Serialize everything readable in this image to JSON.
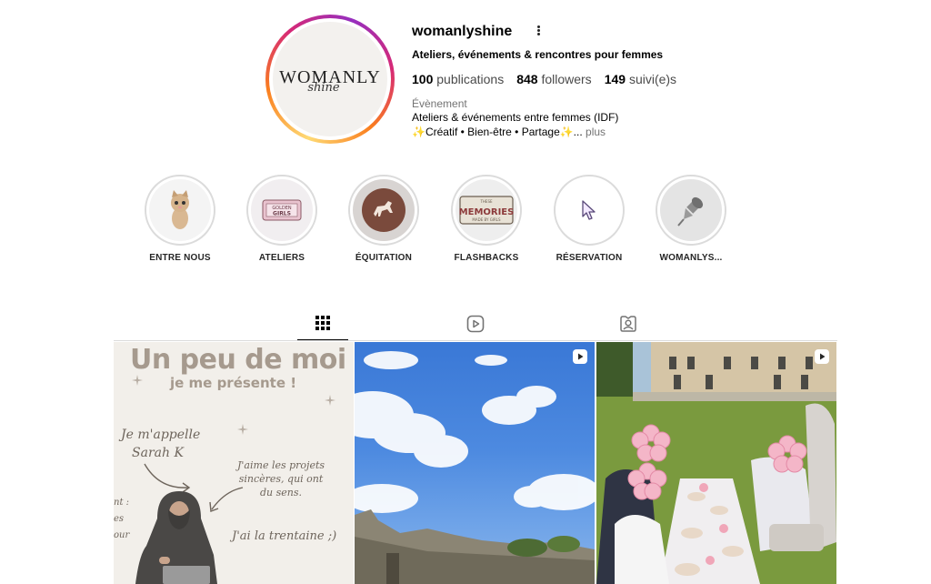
{
  "profile": {
    "username": "womanlyshine",
    "full_name": "Ateliers, événements & rencontres pour femmes",
    "avatar_logo_main": "WOMANLY",
    "avatar_logo_sub": "shine",
    "stats": {
      "posts_count": "100",
      "posts_label": "publications",
      "followers_count": "848",
      "followers_label": "followers",
      "following_count": "149",
      "following_label": "suivi(e)s"
    },
    "category": "Évènement",
    "bio_line1": "Ateliers & événements entre femmes (IDF)",
    "bio_line2": "✨Créatif • Bien-être • Partage✨...",
    "bio_more": "plus"
  },
  "highlights": [
    {
      "label": "ENTRE NOUS",
      "icon": "kitten-icon"
    },
    {
      "label": "ATELIERS",
      "icon": "badge-girls-icon"
    },
    {
      "label": "ÉQUITATION",
      "icon": "horse-icon"
    },
    {
      "label": "FLASHBACKS",
      "icon": "memories-plate-icon"
    },
    {
      "label": "RÉSERVATION",
      "icon": "cursor-icon"
    },
    {
      "label": "WOMANLYS...",
      "icon": "pushpin-icon"
    }
  ],
  "tabs": [
    {
      "name": "posts",
      "icon": "grid-icon",
      "active": true
    },
    {
      "name": "reels",
      "icon": "reels-icon",
      "active": false
    },
    {
      "name": "tagged",
      "icon": "tagged-icon",
      "active": false
    }
  ],
  "posts": {
    "post1": {
      "title": "Un peu de moi",
      "subtitle": "je me présente !",
      "note1a": "Je m'appelle",
      "note1b": "Sarah K",
      "note2a": "J'aime les projets",
      "note2b": "sincères, qui ont",
      "note2c": "du sens.",
      "note3": "J'ai la trentaine ;)",
      "side_a": "nt :",
      "side_b": "es",
      "side_c": "our"
    }
  },
  "colors": {
    "ring_gradient": [
      "#feda75",
      "#fa7e1e",
      "#d62976",
      "#962fbf"
    ],
    "post1_title": "#a69a8e",
    "muted_text": "#737373"
  }
}
